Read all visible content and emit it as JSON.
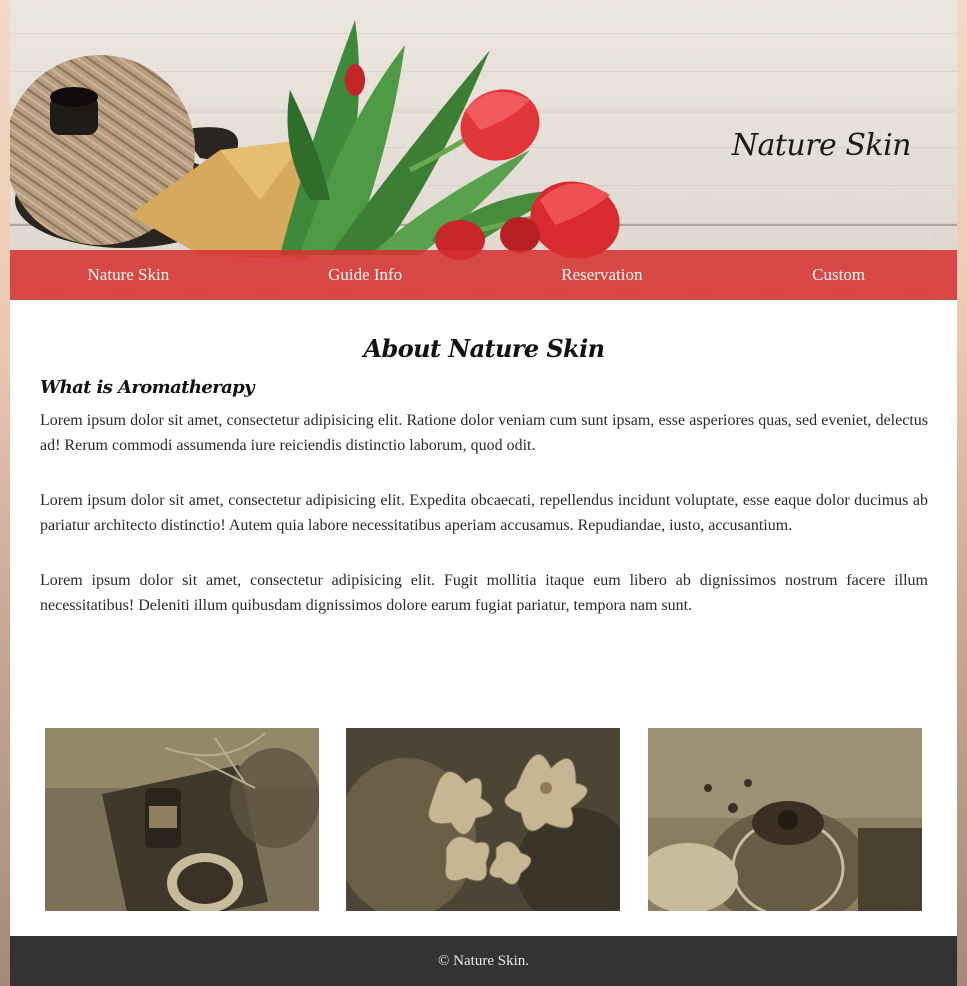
{
  "header": {
    "brand": "Nature Skin"
  },
  "nav": {
    "items": [
      {
        "label": "Nature Skin"
      },
      {
        "label": "Guide Info"
      },
      {
        "label": "Reservation"
      },
      {
        "label": "Custom"
      }
    ]
  },
  "main": {
    "title": "About Nature Skin",
    "section_title": "What is Aromatherapy",
    "paragraphs": [
      "Lorem ipsum dolor sit amet, consectetur adipisicing elit. Ratione dolor veniam cum sunt ipsam, esse asperiores quas, sed eveniet, delectus ad! Rerum commodi assumenda iure reiciendis distinctio laborum, quod odit.",
      "Lorem ipsum dolor sit amet, consectetur adipisicing elit. Expedita obcaecati, repellendus incidunt voluptate, esse eaque dolor ducimus ab pariatur architecto distinctio! Autem quia labore necessitatibus aperiam accusamus. Repudiandae, iusto, accusantium.",
      "Lorem ipsum dolor sit amet, consectetur adipisicing elit. Fugit mollitia itaque eum libero ab dignissimos nostrum facere illum necessitatibus! Deleniti illum quibusdam dignissimos dolore earum fugiat pariatur, tempora nam sunt."
    ]
  },
  "gallery": {
    "images": [
      {
        "name": "aroma-oil-tea-photo"
      },
      {
        "name": "flowers-in-hands-photo"
      },
      {
        "name": "flower-in-glass-photo"
      }
    ]
  },
  "footer": {
    "text": "© Nature Skin."
  },
  "colors": {
    "nav_bg": "#d63030",
    "footer_bg": "#333333",
    "photo_tint": "#8a7a5c"
  }
}
